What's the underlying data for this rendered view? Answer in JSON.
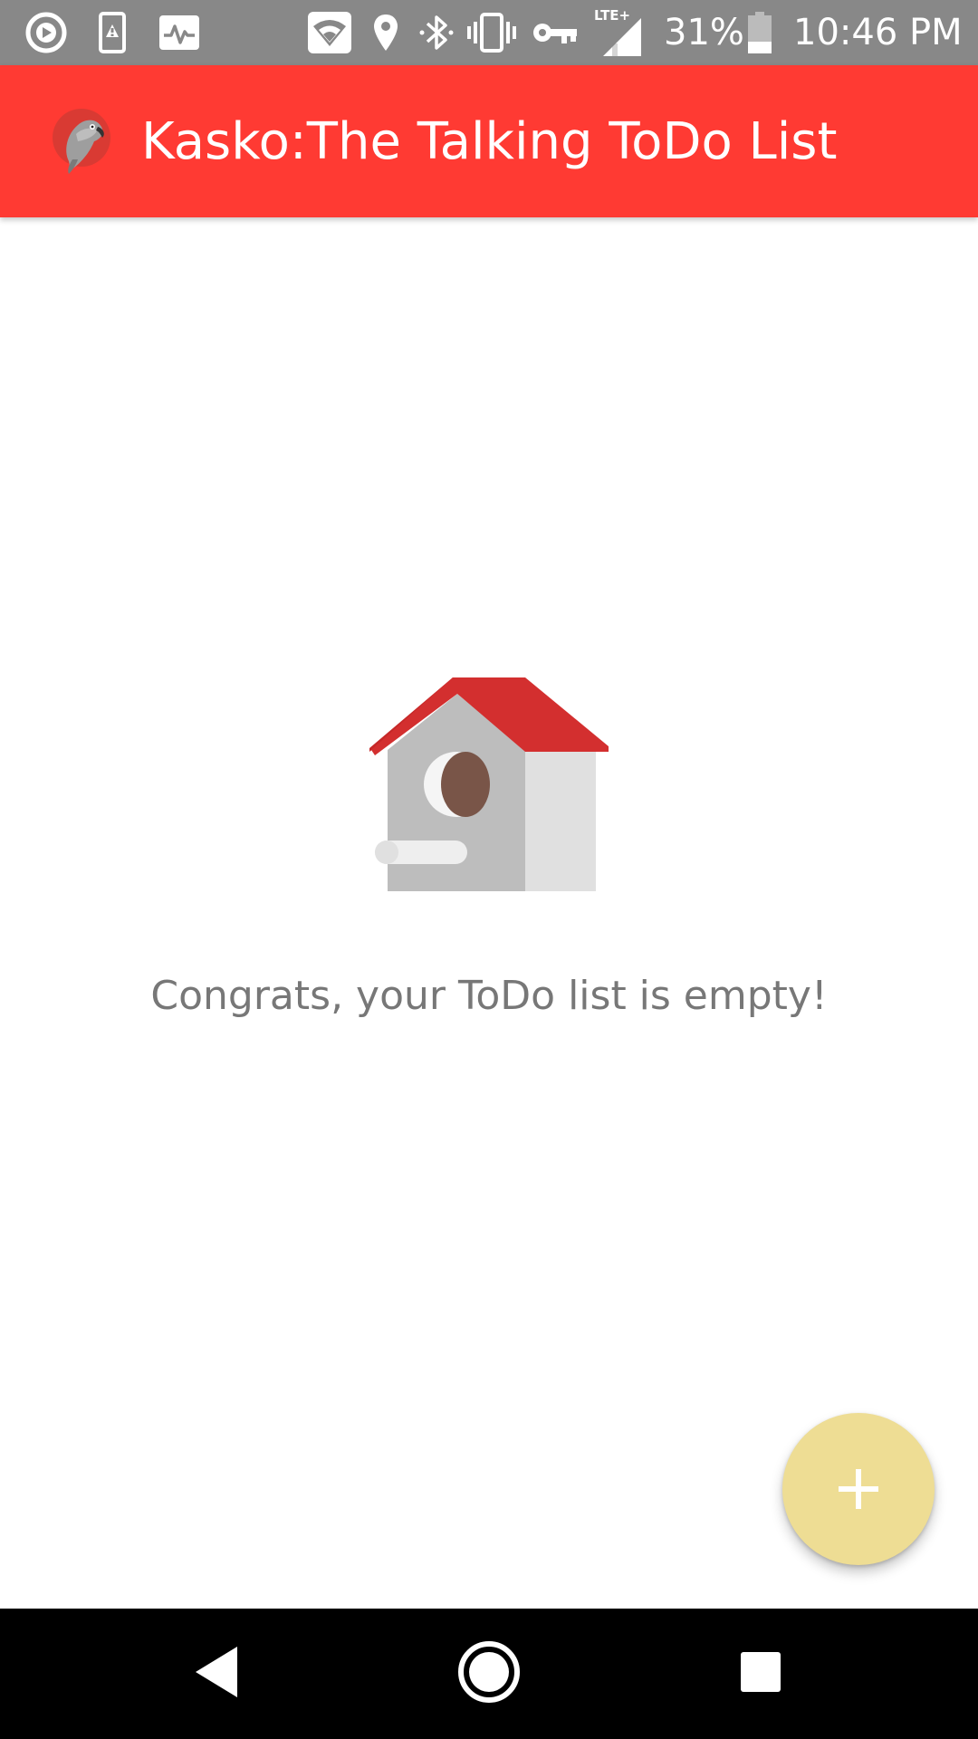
{
  "status_bar": {
    "battery_percent": "31%",
    "time": "10:46 PM",
    "network_label": "LTE+",
    "icons": [
      "media-play-icon",
      "alert-phone-icon",
      "activity-monitor-icon",
      "wifi-icon",
      "location-pin-icon",
      "bluetooth-icon",
      "vibrate-icon",
      "vpn-key-icon",
      "cell-signal-icon",
      "battery-icon"
    ],
    "background_color": "#888888"
  },
  "app_bar": {
    "title": "Kasko:The Talking ToDo List",
    "logo_icon": "parrot-logo-icon",
    "background_color": "#ff3a33"
  },
  "empty_state": {
    "illustration_icon": "birdhouse-icon",
    "message": "Congrats, your ToDo list is empty!"
  },
  "fab": {
    "icon": "plus-icon",
    "color": "#eedd94"
  },
  "nav_bar": {
    "buttons": [
      "back-icon",
      "home-icon",
      "recents-icon"
    ]
  }
}
